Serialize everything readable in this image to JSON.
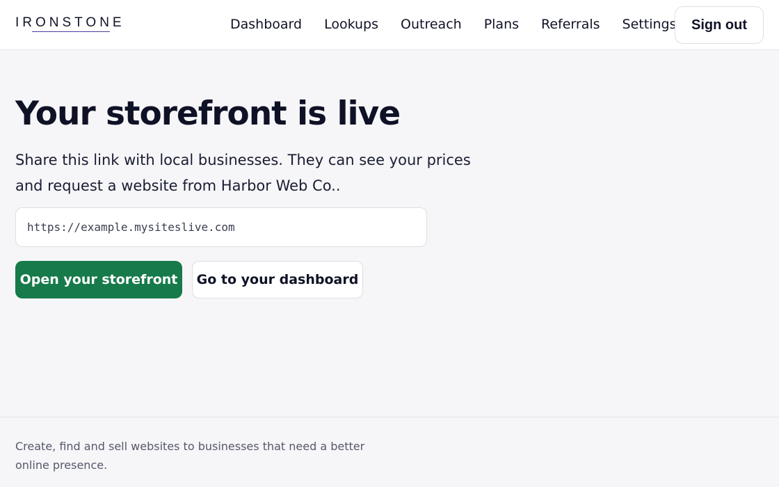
{
  "brand": {
    "logo_text": "IRONSTONE",
    "accent_color": "#177a4a",
    "logo_underline_color": "#4a3f9f"
  },
  "nav": {
    "items": [
      {
        "label": "Dashboard"
      },
      {
        "label": "Lookups"
      },
      {
        "label": "Outreach"
      },
      {
        "label": "Plans"
      },
      {
        "label": "Referrals"
      },
      {
        "label": "Settings"
      }
    ],
    "signout_label": "Sign out"
  },
  "main": {
    "title": "Your storefront is live",
    "subtitle": "Share this link with local businesses. They can see your prices and request a website from Harbor Web Co..",
    "storefront_url": "https://example.mysiteslive.com",
    "primary_button": "Open your storefront",
    "secondary_button": "Go to your dashboard"
  },
  "footer": {
    "tagline": "Create, find and sell websites to businesses that need a better online presence."
  }
}
